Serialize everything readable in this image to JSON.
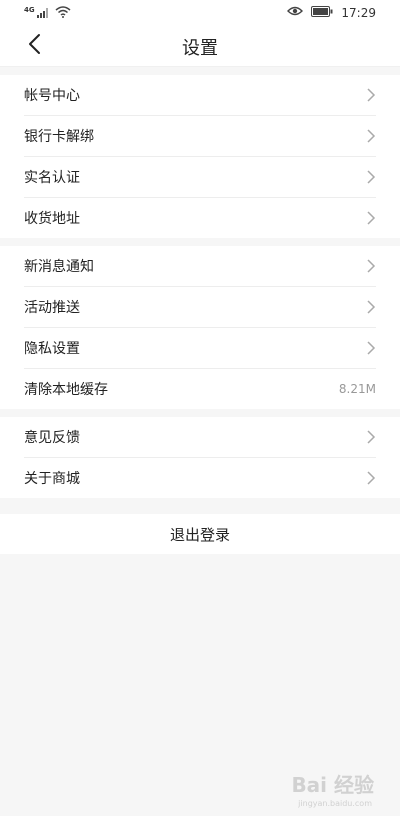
{
  "status_bar": {
    "network": "4G",
    "time": "17:29",
    "icons": [
      "signal-icon",
      "wifi-icon",
      "eye-icon",
      "battery-icon"
    ]
  },
  "header": {
    "title": "设置",
    "back_icon": "chevron-left-icon"
  },
  "groups": [
    {
      "items": [
        {
          "label": "帐号中心"
        },
        {
          "label": "银行卡解绑"
        },
        {
          "label": "实名认证"
        },
        {
          "label": "收货地址"
        }
      ]
    },
    {
      "items": [
        {
          "label": "新消息通知"
        },
        {
          "label": "活动推送"
        },
        {
          "label": "隐私设置"
        },
        {
          "label": "清除本地缓存",
          "value": "8.21M"
        }
      ]
    },
    {
      "items": [
        {
          "label": "意见反馈"
        },
        {
          "label": "关于商城"
        }
      ]
    }
  ],
  "logout": {
    "label": "退出登录"
  },
  "watermark": {
    "text": "Bai 经验",
    "sub": "jingyan.baidu.com"
  },
  "colors": {
    "background": "#f6f6f6",
    "surface": "#ffffff",
    "text": "#222222",
    "muted": "#999999",
    "divider": "#ededed"
  }
}
